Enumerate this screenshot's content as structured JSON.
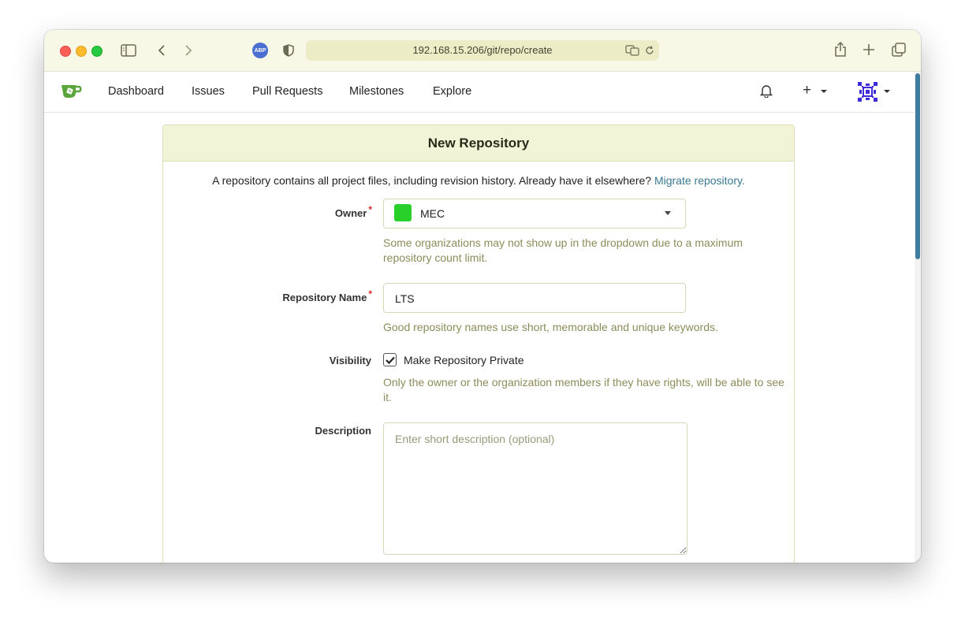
{
  "browser": {
    "url": "192.168.15.206/git/repo/create",
    "abp_label": "ABP"
  },
  "nav": {
    "items": [
      "Dashboard",
      "Issues",
      "Pull Requests",
      "Milestones",
      "Explore"
    ],
    "plus_label": "+"
  },
  "page": {
    "title": "New Repository",
    "intro_text": "A repository contains all project files, including revision history. Already have it elsewhere?",
    "migrate_link": "Migrate repository."
  },
  "form": {
    "owner_label": "Owner",
    "owner_value": "MEC",
    "owner_help": "Some organizations may not show up in the dropdown due to a maximum repository count limit.",
    "repo_name_label": "Repository Name",
    "repo_name_value": "LTS",
    "repo_name_help": "Good repository names use short, memorable and unique keywords.",
    "visibility_label": "Visibility",
    "private_label": "Make Repository Private",
    "private_checked": true,
    "visibility_help": "Only the owner or the organization members if they have rights, will be able to see it.",
    "description_label": "Description",
    "description_placeholder": "Enter short description (optional)",
    "required_mark": "*"
  },
  "colors": {
    "accent": "#3a7891",
    "header_bg": "#f1f4d6",
    "help_text": "#8c8c5a",
    "owner_avatar": "#2ad02a",
    "logo": "#5aa43c"
  }
}
